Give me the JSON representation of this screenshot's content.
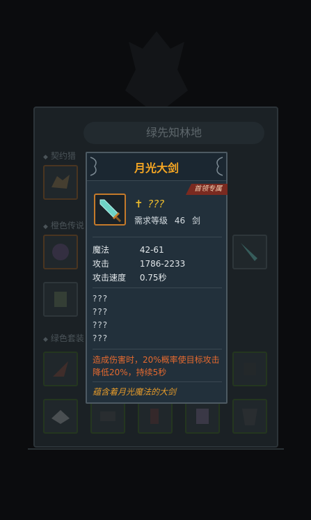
{
  "background_panel": {
    "title": "绿先知林地",
    "sections": [
      "契约猎",
      "橙色传说",
      "绿色套装"
    ]
  },
  "tooltip": {
    "title": "月光大剑",
    "badge": "首领专属",
    "item_icon": "greatsword-icon",
    "level_symbol": "✝",
    "level_text": "???",
    "requirement_label": "需求等级",
    "requirement_value": "46",
    "weapon_type": "剑",
    "stats": [
      {
        "key": "魔法",
        "value": "42-61"
      },
      {
        "key": "攻击",
        "value": "1786-2233"
      },
      {
        "key": "攻击速度",
        "value": "0.75秒"
      }
    ],
    "unknown_lines": [
      "???",
      "???",
      "???",
      "???"
    ],
    "effect": "造成伤害时，20%概率使目标攻击降低20%，持续5秒",
    "flavor": "蕴含着月光魔法的大剑"
  },
  "colors": {
    "title": "#f5a623",
    "effect": "#e66a2f",
    "flavor": "#e69b2a",
    "badge_bg": "#7a2a20",
    "icon_border": "#c57a2a"
  }
}
